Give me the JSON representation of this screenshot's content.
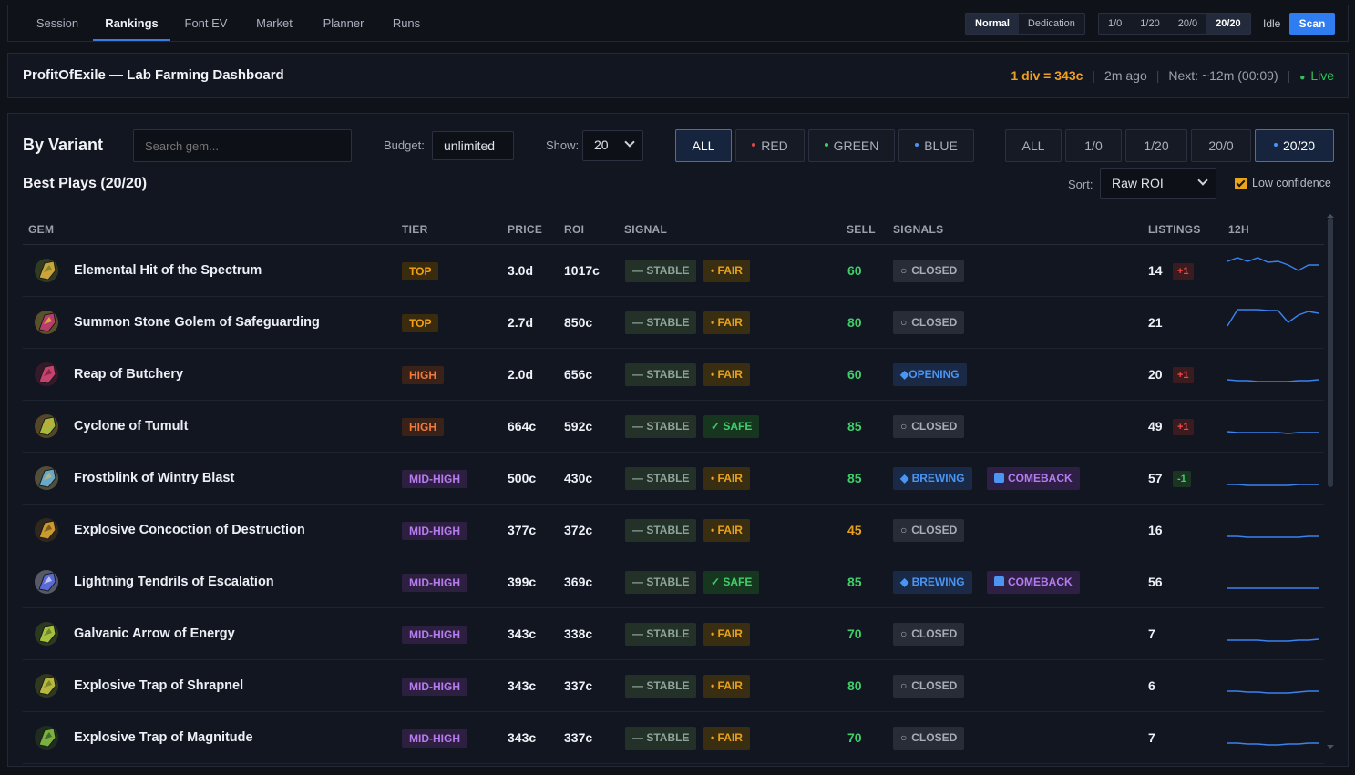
{
  "nav": {
    "tabs": [
      "Session",
      "Rankings",
      "Font EV",
      "Market",
      "Planner",
      "Runs"
    ],
    "active_tab": "Rankings",
    "mode": [
      "Normal",
      "Dedication"
    ],
    "mode_active": "Normal",
    "ratio": [
      "1/0",
      "1/20",
      "20/0",
      "20/20"
    ],
    "ratio_active": "20/20",
    "status": "Idle",
    "scan_label": "Scan"
  },
  "header": {
    "title": "ProfitOfExile — Lab Farming Dashboard",
    "rate": "1 div = 343c",
    "updated": "2m ago",
    "next": "Next: ~12m (00:09)",
    "live": "Live"
  },
  "panel": {
    "title": "By Variant",
    "search_placeholder": "Search gem...",
    "budget_label": "Budget:",
    "budget_value": "unlimited",
    "show_label": "Show:",
    "show_value": "20",
    "color_filters": [
      "ALL",
      "RED",
      "GREEN",
      "BLUE"
    ],
    "variant_filters": [
      "ALL",
      "1/0",
      "1/20",
      "20/0",
      "20/20"
    ],
    "best_title": "Best Plays (20/20)",
    "sort_label": "Sort:",
    "sort_value": "Raw ROI",
    "low_conf_label": "Low confidence"
  },
  "colors": {
    "red": "#e04848",
    "green": "#3fcf6a",
    "blue": "#4b95f3",
    "accent": "#2f7df0"
  },
  "table": {
    "headers": [
      "GEM",
      "TIER",
      "PRICE",
      "ROI",
      "SIGNAL",
      "SELL",
      "SIGNALS",
      "LISTINGS",
      "12H"
    ],
    "rows": [
      {
        "gem": "Elemental Hit of the Spectrum",
        "icon": "gem-elemental-hit-icon",
        "tier": "TOP",
        "tier_class": "top",
        "price": "3.0d",
        "roi": "1017c",
        "stability": "— STABLE",
        "risk": "• FAIR",
        "risk_class": "fair",
        "sell": "60",
        "sell_color": "#3fcf6a",
        "signal": "CLOSED",
        "signal_class": "closed",
        "signal_icon": "○",
        "extra": "",
        "listings": "14",
        "delta": "+1",
        "delta_class": "up",
        "spark": [
          8,
          4,
          8,
          4,
          9,
          8,
          12,
          18,
          12,
          12
        ]
      },
      {
        "gem": "Summon Stone Golem of Safeguarding",
        "icon": "gem-stone-golem-icon",
        "tier": "TOP",
        "tier_class": "top",
        "price": "2.7d",
        "roi": "850c",
        "stability": "— STABLE",
        "risk": "• FAIR",
        "risk_class": "fair",
        "sell": "80",
        "sell_color": "#3fcf6a",
        "signal": "CLOSED",
        "signal_class": "closed",
        "signal_icon": "○",
        "extra": "",
        "listings": "21",
        "delta": "",
        "delta_class": "",
        "spark": [
          22,
          4,
          4,
          4,
          5,
          5,
          18,
          10,
          6,
          8
        ]
      },
      {
        "gem": "Reap of Butchery",
        "icon": "gem-reap-icon",
        "tier": "HIGH",
        "tier_class": "high",
        "price": "2.0d",
        "roi": "656c",
        "stability": "— STABLE",
        "risk": "• FAIR",
        "risk_class": "fair",
        "sell": "60",
        "sell_color": "#3fcf6a",
        "signal": "◆OPENING",
        "signal_class": "opening",
        "signal_icon": "",
        "extra": "",
        "listings": "20",
        "delta": "+1",
        "delta_class": "up",
        "spark": [
          24,
          25,
          25,
          26,
          26,
          26,
          26,
          25,
          25,
          24
        ]
      },
      {
        "gem": "Cyclone of Tumult",
        "icon": "gem-cyclone-icon",
        "tier": "HIGH",
        "tier_class": "high",
        "price": "664c",
        "roi": "592c",
        "stability": "— STABLE",
        "risk": "✓ SAFE",
        "risk_class": "safe",
        "sell": "85",
        "sell_color": "#3fcf6a",
        "signal": "CLOSED",
        "signal_class": "closed",
        "signal_icon": "○",
        "extra": "",
        "listings": "49",
        "delta": "+1",
        "delta_class": "up",
        "spark": [
          24,
          25,
          25,
          25,
          25,
          25,
          26,
          25,
          25,
          25
        ]
      },
      {
        "gem": "Frostblink of Wintry Blast",
        "icon": "gem-frostblink-icon",
        "tier": "MID-HIGH",
        "tier_class": "midhigh",
        "price": "500c",
        "roi": "430c",
        "stability": "— STABLE",
        "risk": "• FAIR",
        "risk_class": "fair",
        "sell": "85",
        "sell_color": "#3fcf6a",
        "signal": "◆ BREWING",
        "signal_class": "brewing",
        "signal_icon": "",
        "extra": "COMEBACK",
        "listings": "57",
        "delta": "-1",
        "delta_class": "down",
        "spark": [
          25,
          25,
          26,
          26,
          26,
          26,
          26,
          25,
          25,
          25
        ]
      },
      {
        "gem": "Explosive Concoction of Destruction",
        "icon": "gem-concoction-icon",
        "tier": "MID-HIGH",
        "tier_class": "midhigh",
        "price": "377c",
        "roi": "372c",
        "stability": "— STABLE",
        "risk": "• FAIR",
        "risk_class": "fair",
        "sell": "45",
        "sell_color": "#e8a21a",
        "signal": "CLOSED",
        "signal_class": "closed",
        "signal_icon": "○",
        "extra": "",
        "listings": "16",
        "delta": "",
        "delta_class": "",
        "spark": [
          25,
          25,
          26,
          26,
          26,
          26,
          26,
          26,
          25,
          25
        ]
      },
      {
        "gem": "Lightning Tendrils of Escalation",
        "icon": "gem-lightning-tendrils-icon",
        "tier": "MID-HIGH",
        "tier_class": "midhigh",
        "price": "399c",
        "roi": "369c",
        "stability": "— STABLE",
        "risk": "✓ SAFE",
        "risk_class": "safe",
        "sell": "85",
        "sell_color": "#3fcf6a",
        "signal": "◆ BREWING",
        "signal_class": "brewing",
        "signal_icon": "",
        "extra": "COMEBACK",
        "listings": "56",
        "delta": "",
        "delta_class": "",
        "spark": [
          25,
          25,
          25,
          25,
          25,
          25,
          25,
          25,
          25,
          25
        ]
      },
      {
        "gem": "Galvanic Arrow of Energy",
        "icon": "gem-galvanic-arrow-icon",
        "tier": "MID-HIGH",
        "tier_class": "midhigh",
        "price": "343c",
        "roi": "338c",
        "stability": "— STABLE",
        "risk": "• FAIR",
        "risk_class": "fair",
        "sell": "70",
        "sell_color": "#3fcf6a",
        "signal": "CLOSED",
        "signal_class": "closed",
        "signal_icon": "○",
        "extra": "",
        "listings": "7",
        "delta": "",
        "delta_class": "",
        "spark": [
          25,
          25,
          25,
          25,
          26,
          26,
          26,
          25,
          25,
          24
        ]
      },
      {
        "gem": "Explosive Trap of Shrapnel",
        "icon": "gem-explosive-trap-icon",
        "tier": "MID-HIGH",
        "tier_class": "midhigh",
        "price": "343c",
        "roi": "337c",
        "stability": "— STABLE",
        "risk": "• FAIR",
        "risk_class": "fair",
        "sell": "80",
        "sell_color": "#3fcf6a",
        "signal": "CLOSED",
        "signal_class": "closed",
        "signal_icon": "○",
        "extra": "",
        "listings": "6",
        "delta": "",
        "delta_class": "",
        "spark": [
          24,
          24,
          25,
          25,
          26,
          26,
          26,
          25,
          24,
          24
        ]
      },
      {
        "gem": "Explosive Trap of Magnitude",
        "icon": "gem-explosive-trap-2-icon",
        "tier": "MID-HIGH",
        "tier_class": "midhigh",
        "price": "343c",
        "roi": "337c",
        "stability": "— STABLE",
        "risk": "• FAIR",
        "risk_class": "fair",
        "sell": "70",
        "sell_color": "#3fcf6a",
        "signal": "CLOSED",
        "signal_class": "closed",
        "signal_icon": "○",
        "extra": "",
        "listings": "7",
        "delta": "",
        "delta_class": "",
        "spark": [
          24,
          24,
          25,
          25,
          26,
          26,
          25,
          25,
          24,
          24
        ]
      }
    ]
  }
}
